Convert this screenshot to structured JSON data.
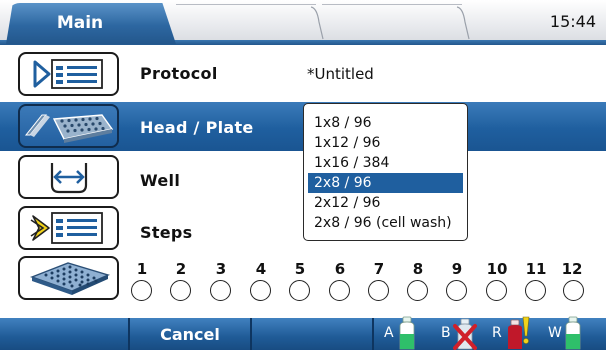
{
  "tabs": {
    "main_label": "Main"
  },
  "clock": "15:44",
  "rows": {
    "protocol": {
      "label": "Protocol",
      "value": "*Untitled",
      "icon": "protocol-list-icon"
    },
    "head_plate": {
      "label": "Head / Plate",
      "icon": "plate-head-icon"
    },
    "well": {
      "label": "Well",
      "icon": "well-position-icon"
    },
    "steps": {
      "label": "Steps",
      "icon": "steps-list-icon"
    }
  },
  "dropdown": {
    "options": [
      "1x8 / 96",
      "1x12 / 96",
      "1x16 / 384",
      "2x8 / 96",
      "2x12 / 96",
      "2x8 / 96 (cell wash)"
    ],
    "selected": "2x8 / 96"
  },
  "strips": {
    "numbers": [
      "1",
      "2",
      "3",
      "4",
      "5",
      "6",
      "7",
      "8",
      "9",
      "10",
      "11",
      "12"
    ],
    "icon": "microplate-icon"
  },
  "bottom": {
    "cancel_label": "Cancel",
    "resources": [
      {
        "label": "A",
        "icon": "bottle-green-icon",
        "status": "ok"
      },
      {
        "label": "B",
        "icon": "bottle-empty-crossed-icon",
        "status": "missing"
      },
      {
        "label": "R",
        "icon": "bottle-red-warning-icon",
        "status": "warning"
      },
      {
        "label": "W",
        "icon": "bottle-green-icon",
        "status": "ok"
      }
    ]
  },
  "colors": {
    "accent_blue": "#1f5f9f",
    "tab_blue": "#2d67a1",
    "selection_blue": "#1f5f9f",
    "bottle_green": "#2fbf6a",
    "bottle_red": "#c0182a",
    "cross_red": "#d0202a",
    "warning_yellow": "#f1d21a"
  }
}
